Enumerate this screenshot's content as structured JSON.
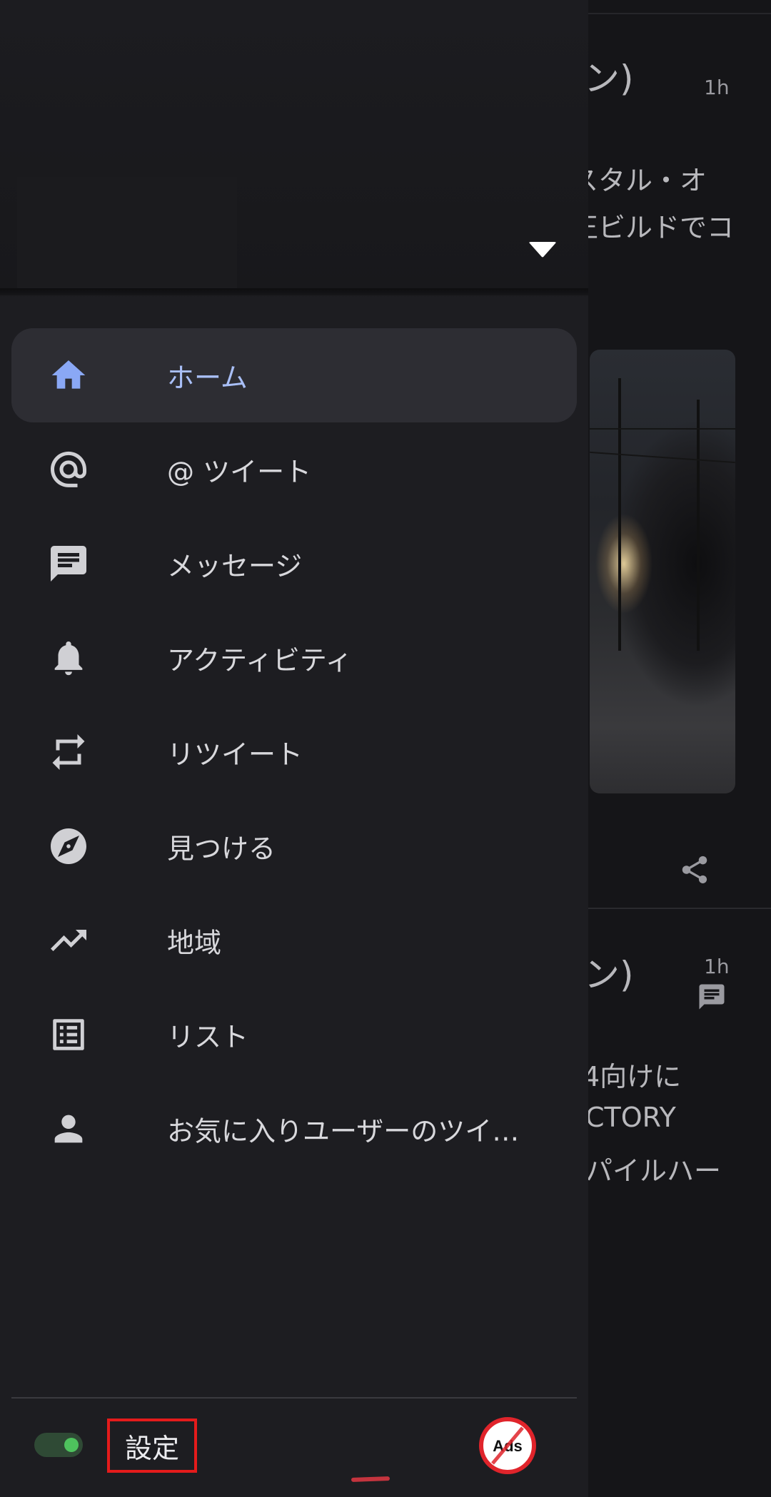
{
  "timeline": {
    "tweet1": {
      "name_fragment": "ン)",
      "time": "1h",
      "line1": "スタル・オ",
      "line2": "正ビルドでコ"
    },
    "tweet2": {
      "name_fragment": "ン)",
      "time": "1h",
      "line1": "4向けに",
      "line2": "CTORY",
      "line3": "パイルハー"
    }
  },
  "drawer": {
    "nav": [
      {
        "id": "home",
        "label": "ホーム",
        "icon": "home-icon",
        "active": true
      },
      {
        "id": "mentions",
        "label": "@ ツイート",
        "icon": "at-icon",
        "active": false
      },
      {
        "id": "messages",
        "label": "メッセージ",
        "icon": "message-icon",
        "active": false
      },
      {
        "id": "activity",
        "label": "アクティビティ",
        "icon": "bell-icon",
        "active": false
      },
      {
        "id": "retweets",
        "label": "リツイート",
        "icon": "retweet-icon",
        "active": false
      },
      {
        "id": "discover",
        "label": "見つける",
        "icon": "compass-icon",
        "active": false
      },
      {
        "id": "trends",
        "label": "地域",
        "icon": "trending-icon",
        "active": false
      },
      {
        "id": "lists",
        "label": "リスト",
        "icon": "list-icon",
        "active": false
      },
      {
        "id": "favorites",
        "label": "お気に入りユーザーのツイート",
        "icon": "person-icon",
        "active": false
      }
    ],
    "footer": {
      "settings_label": "設定",
      "ads_label": "Ads"
    }
  },
  "colors": {
    "active_text": "#a9bff7",
    "icon_active": "#8aa8f5",
    "switch_on": "#4ec25d",
    "highlight": "#e41b1b"
  }
}
